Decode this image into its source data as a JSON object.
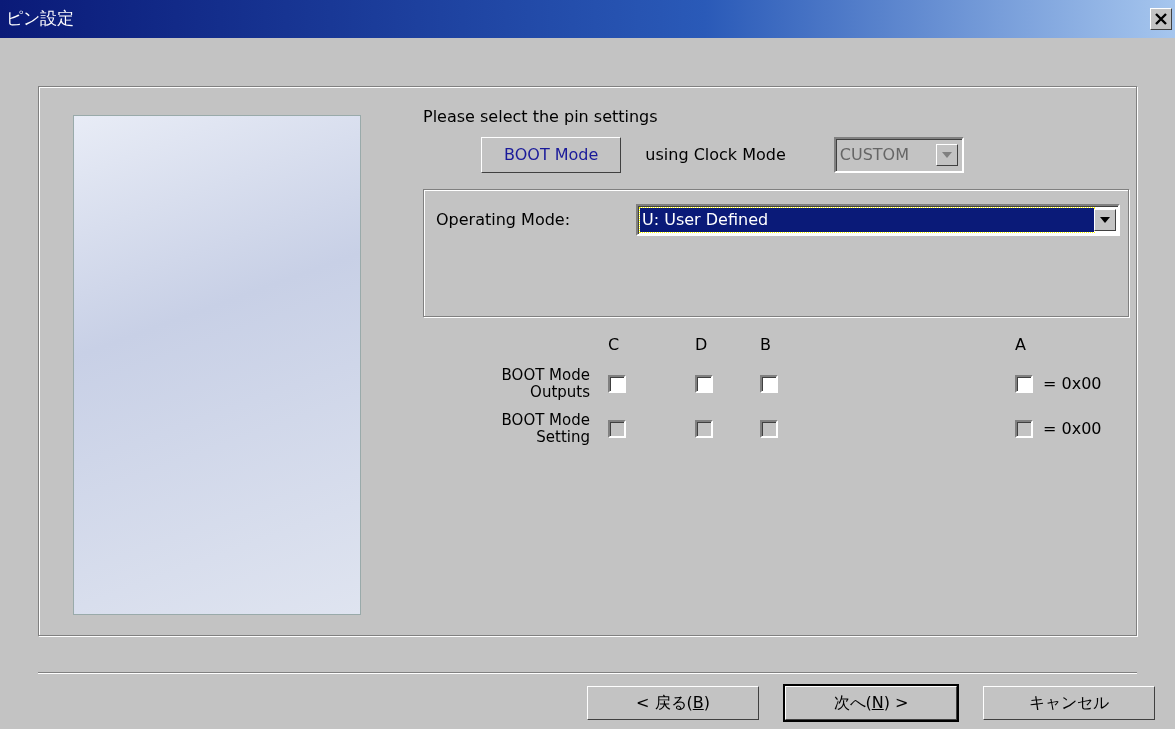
{
  "window": {
    "title": "ピン設定"
  },
  "prompt": "Please select the pin settings",
  "mode_button": {
    "label": "BOOT Mode"
  },
  "clock_label": "using Clock Mode",
  "clock_select": {
    "value": "CUSTOM",
    "disabled": true
  },
  "operating_mode": {
    "label": "Operating Mode:",
    "value": "U: User Defined",
    "focused": true
  },
  "pin_columns": [
    "C",
    "D",
    "B",
    "A"
  ],
  "pin_rows": [
    {
      "label": "BOOT Mode Outputs",
      "value": "= 0x00",
      "checks": [
        {
          "checked": false,
          "disabled": false
        },
        {
          "checked": false,
          "disabled": false
        },
        {
          "checked": false,
          "disabled": false
        },
        {
          "checked": false,
          "disabled": false
        }
      ]
    },
    {
      "label": "BOOT Mode Setting",
      "value": "= 0x00",
      "checks": [
        {
          "checked": false,
          "disabled": true
        },
        {
          "checked": false,
          "disabled": true
        },
        {
          "checked": false,
          "disabled": true
        },
        {
          "checked": false,
          "disabled": true
        }
      ]
    }
  ],
  "buttons": [
    {
      "before": "< 戻る(",
      "mnemonic": "B",
      "after": ")",
      "default": false
    },
    {
      "before": "次へ(",
      "mnemonic": "N",
      "after": ") >",
      "default": true
    },
    {
      "before": "キャンセル",
      "default": false
    }
  ]
}
